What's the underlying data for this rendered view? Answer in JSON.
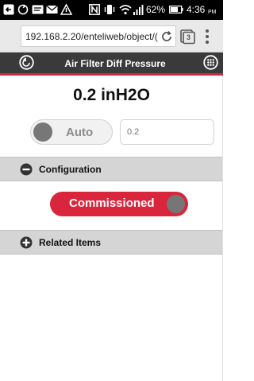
{
  "status_bar": {
    "battery": "62%",
    "time": "4:36",
    "ampm": "PM",
    "icons": [
      "back-arrow-icon",
      "sync-icon",
      "message-icon",
      "mail-icon",
      "alert-icon",
      "nfc-icon",
      "vibrate-icon",
      "wifi-icon",
      "signal-icon",
      "battery-icon"
    ]
  },
  "browser": {
    "url": "192.168.2.20/enteliweb/object/(",
    "tab_count": "3",
    "icons": [
      "reload-icon",
      "tabs-icon",
      "overflow-menu-icon"
    ]
  },
  "header": {
    "title": "Air Filter Diff Pressure",
    "icons": [
      "back-icon",
      "grid-menu-icon"
    ]
  },
  "value": {
    "number": "0.2",
    "unit": "inH2O",
    "display": "0.2 inH2O"
  },
  "auto_toggle": {
    "label": "Auto",
    "state": "off"
  },
  "value_input": {
    "placeholder": "0.2"
  },
  "configuration": {
    "label": "Configuration",
    "expanded": true,
    "commissioned": {
      "label": "Commissioned",
      "state": "on"
    }
  },
  "related_items": {
    "label": "Related Items",
    "expanded": false
  },
  "colors": {
    "accent_red": "#d9263d",
    "header_bg": "#3a3a3a",
    "section_bg": "#d5d5d5"
  }
}
